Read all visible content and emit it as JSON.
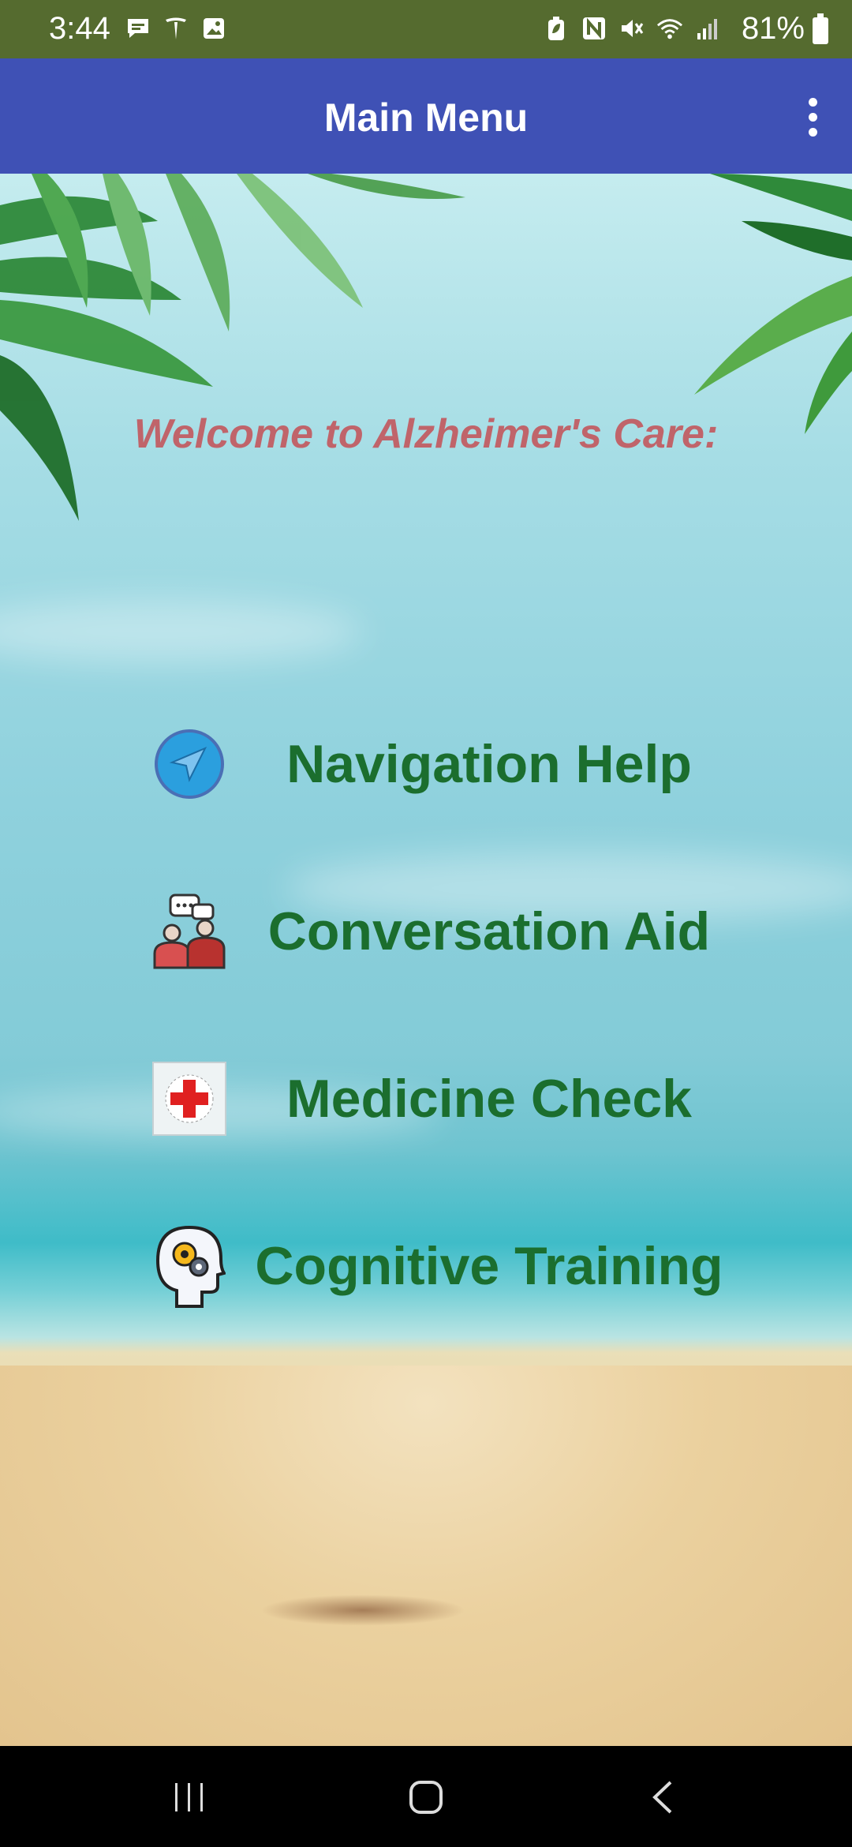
{
  "status_bar": {
    "time": "3:44",
    "battery_text": "81%",
    "left_icons": [
      "chat-icon",
      "tesla-icon",
      "image-icon"
    ],
    "right_icons": [
      "battery-saver-icon",
      "nfc-icon",
      "mute-icon",
      "wifi-icon",
      "signal-icon"
    ]
  },
  "app_bar": {
    "title": "Main Menu",
    "overflow_icon": "more-vert-icon",
    "color": "#3f51b5"
  },
  "main": {
    "welcome": "Welcome to Alzheimer's Care:",
    "welcome_color": "#c0646a",
    "menu_items": [
      {
        "label": "Navigation Help",
        "icon": "navigation-icon"
      },
      {
        "label": "Conversation Aid",
        "icon": "conversation-icon"
      },
      {
        "label": "Medicine Check",
        "icon": "medical-cross-icon"
      },
      {
        "label": "Cognitive Training",
        "icon": "brain-gear-icon"
      }
    ],
    "label_color": "#1b6e2e"
  },
  "nav_bar": {
    "buttons": [
      "recent-apps-icon",
      "home-icon",
      "back-icon"
    ]
  }
}
